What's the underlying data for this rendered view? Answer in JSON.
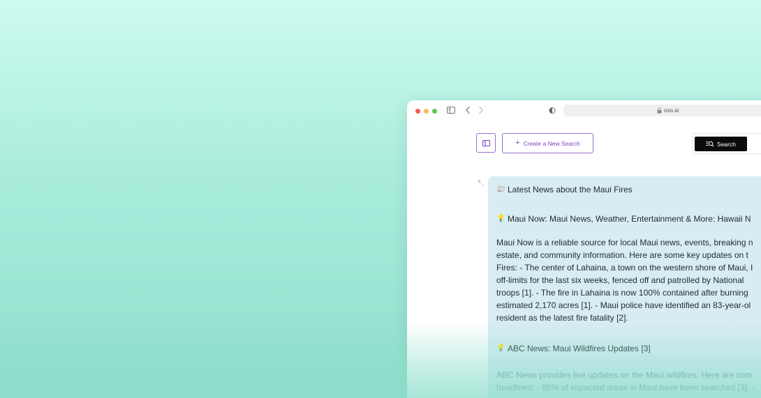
{
  "browser": {
    "url": "oso.ai"
  },
  "toolbar": {
    "create_label": "Create a New Search",
    "create_icon": "+",
    "search_label": "Search"
  },
  "answer": {
    "title_emoji": "📰",
    "title": "Latest News about the Maui Fires",
    "source1_emoji": "💡",
    "source1_title": "Maui Now: Maui News, Weather, Entertainment & More: Hawaii N",
    "source1_body": "Maui Now is a reliable source for local Maui news, events, breaking n\nestate, and community information. Here are some key updates on t\nFires: - The center of Lahaina, a town on the western shore of Maui, I\noff-limits for the last six weeks, fenced off and patrolled by National\ntroops [1]. - The fire in Lahaina is now 100% contained after burning\nestimated 2,170 acres [1]. - Maui police have identified an 83-year-ol\nresident as the latest fire fatality [2].",
    "source2_emoji": "💡",
    "source2_title": "ABC News: Maui Wildfires Updates [3]",
    "source2_body": "ABC News provides live updates on the Maui wildfires. Here are som\nheadlines: - 85% of impacted areas in Maui have been searched [3]. -"
  },
  "icons": {
    "sidebar_toggle": "sidebar-icon",
    "back": "chevron-left-icon",
    "forward": "chevron-right-icon",
    "privacy": "shield-icon",
    "lock": "lock-icon",
    "panel": "panel-icon",
    "search": "search-icon",
    "sparkle": "sparkle-icon"
  },
  "colors": {
    "accent": "#7a3fc4",
    "answer_bg": "#d8ecf3",
    "backdrop_top": "#cdfbef",
    "backdrop_bottom": "#8fdecb"
  }
}
